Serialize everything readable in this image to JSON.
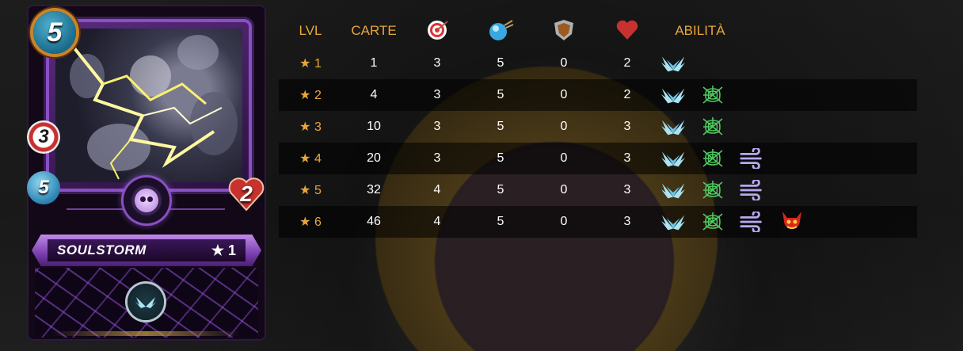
{
  "card": {
    "name": "SOULSTORM",
    "level": "★ 1",
    "mana": "5",
    "ranged": "3",
    "speed": "5",
    "health": "2",
    "ability_icon": "wings-icon",
    "accent": "#8b4fc4"
  },
  "table": {
    "headers": {
      "lvl": "LVL",
      "cards": "CARTE",
      "ranged_icon": "target-icon",
      "speed_icon": "speed-orb-icon",
      "armor_icon": "shield-icon",
      "health_icon": "heart-icon",
      "abilities": "ABILITÀ"
    },
    "rows": [
      {
        "lvl": "★ 1",
        "cards": "1",
        "ranged": "3",
        "speed": "5",
        "armor": "0",
        "health": "2",
        "abilities": [
          "wings-icon"
        ]
      },
      {
        "lvl": "★ 2",
        "cards": "4",
        "ranged": "3",
        "speed": "5",
        "armor": "0",
        "health": "2",
        "abilities": [
          "wings-icon",
          "web-icon"
        ]
      },
      {
        "lvl": "★ 3",
        "cards": "10",
        "ranged": "3",
        "speed": "5",
        "armor": "0",
        "health": "3",
        "abilities": [
          "wings-icon",
          "web-icon"
        ]
      },
      {
        "lvl": "★ 4",
        "cards": "20",
        "ranged": "3",
        "speed": "5",
        "armor": "0",
        "health": "3",
        "abilities": [
          "wings-icon",
          "web-icon",
          "wind-icon"
        ]
      },
      {
        "lvl": "★ 5",
        "cards": "32",
        "ranged": "4",
        "speed": "5",
        "armor": "0",
        "health": "3",
        "abilities": [
          "wings-icon",
          "web-icon",
          "wind-icon"
        ]
      },
      {
        "lvl": "★ 6",
        "cards": "46",
        "ranged": "4",
        "speed": "5",
        "armor": "0",
        "health": "3",
        "abilities": [
          "wings-icon",
          "web-icon",
          "wind-icon",
          "demon-icon"
        ]
      }
    ],
    "colors": {
      "header": "#e8a73a",
      "text": "#ffffff"
    }
  }
}
